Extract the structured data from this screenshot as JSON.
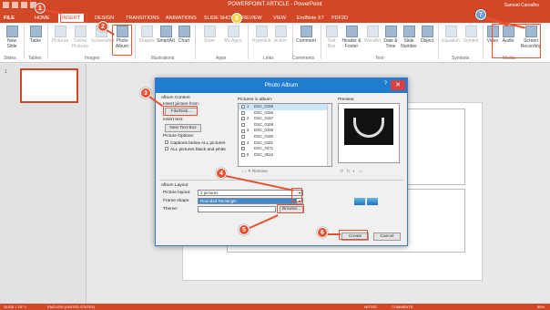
{
  "window": {
    "title": "POWERPOINT ARTICLE - PowerPoint",
    "user": "Samuel Carvalho"
  },
  "tabs": [
    "FILE",
    "HOME",
    "INSERT",
    "DESIGN",
    "TRANSITIONS",
    "ANIMATIONS",
    "SLIDE SHOW",
    "REVIEW",
    "VIEW",
    "EndNote X7",
    "PDF2D"
  ],
  "active_tab": "INSERT",
  "ribbon": {
    "buttons": [
      {
        "label": "New Slide",
        "dim": false
      },
      {
        "label": "Table",
        "dim": false
      },
      {
        "label": "Pictures",
        "dim": true
      },
      {
        "label": "Online Pictures",
        "dim": true
      },
      {
        "label": "Screenshot",
        "dim": true
      },
      {
        "label": "Photo Album",
        "dim": false
      },
      {
        "label": "Shapes",
        "dim": true
      },
      {
        "label": "SmartArt",
        "dim": false
      },
      {
        "label": "Chart",
        "dim": false
      },
      {
        "label": "Store",
        "dim": true
      },
      {
        "label": "My Apps",
        "dim": true
      },
      {
        "label": "Hyperlink",
        "dim": true
      },
      {
        "label": "Action",
        "dim": true
      },
      {
        "label": "Comment",
        "dim": false
      },
      {
        "label": "Text Box",
        "dim": true
      },
      {
        "label": "Header & Footer",
        "dim": false
      },
      {
        "label": "WordArt",
        "dim": true
      },
      {
        "label": "Date & Time",
        "dim": false
      },
      {
        "label": "Slide Number",
        "dim": false
      },
      {
        "label": "Object",
        "dim": false
      },
      {
        "label": "Equation",
        "dim": true
      },
      {
        "label": "Symbol",
        "dim": true
      },
      {
        "label": "Video",
        "dim": false
      },
      {
        "label": "Audio",
        "dim": false
      },
      {
        "label": "Screen Recording",
        "dim": false
      }
    ],
    "groups": [
      "Slides",
      "Tables",
      "Images",
      "Illustrations",
      "Apps",
      "Links",
      "Comments",
      "Text",
      "Symbols",
      "Media"
    ]
  },
  "thumbnail_number": "1",
  "dialog": {
    "title": "Photo Album",
    "help": "?",
    "close": "✕",
    "album_content": "Album Content",
    "insert_picture_from": "Insert picture from:",
    "file_disk_button": "File/Disk...",
    "insert_text": "Insert text:",
    "new_text_box_button": "New Text Box",
    "picture_options": "Picture Options:",
    "captions_option": "Captions below ALL pictures",
    "bw_option": "ALL pictures black and white",
    "pictures_in_album": "Pictures in album:",
    "preview_label": "Preview:",
    "pictures": [
      {
        "num": "1",
        "name": "DSC_0155"
      },
      {
        "num": "",
        "name": "DSC_0156"
      },
      {
        "num": "2",
        "name": "DSC_0157"
      },
      {
        "num": "",
        "name": "DSC_0158"
      },
      {
        "num": "3",
        "name": "DSC_0159"
      },
      {
        "num": "",
        "name": "DSC_0160"
      },
      {
        "num": "4",
        "name": "DSC_0161"
      },
      {
        "num": "",
        "name": "DSC_0471"
      },
      {
        "num": "5",
        "name": "DSC_0516"
      }
    ],
    "remove_button": "✕ Remove",
    "album_layout": "Album Layout",
    "picture_layout_label": "Picture layout:",
    "picture_layout_value": "2 pictures",
    "frame_shape_label": "Frame shape:",
    "frame_shape_value": "Rounded Rectangle",
    "theme_label": "Theme:",
    "browse_button": "Browse...",
    "create_button": "Create",
    "cancel_button": "Cancel"
  },
  "callouts": [
    "1",
    "2",
    "3",
    "4",
    "5",
    "6",
    "7",
    "8"
  ],
  "status": {
    "slide": "SLIDE 1 OF 1",
    "language": "ENGLISH (UNITED STATES)",
    "notes": "NOTES",
    "comments": "COMMENTS",
    "zoom": "85%"
  },
  "colors": {
    "accent": "#d24726",
    "callout": "#e8502f",
    "dialog_title": "#1f7ccf"
  }
}
